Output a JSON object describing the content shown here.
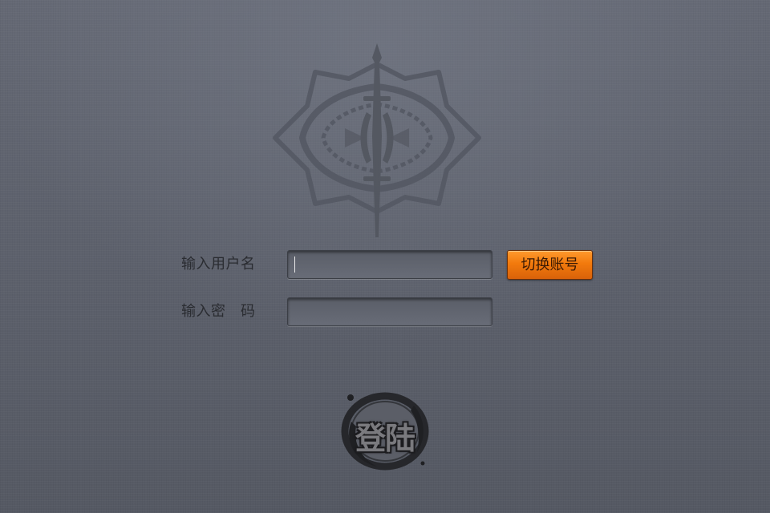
{
  "background": {
    "base_color": "#5f636d",
    "emblem_icon": "ornate-spear-shield-emblem"
  },
  "login_form": {
    "username_label": "输入用户名",
    "username_value": "",
    "password_label": "输入密　码",
    "password_value": "",
    "switch_account_label": "切换账号",
    "switch_account_color": "#f27a0c",
    "login_button_label": "登陆"
  }
}
